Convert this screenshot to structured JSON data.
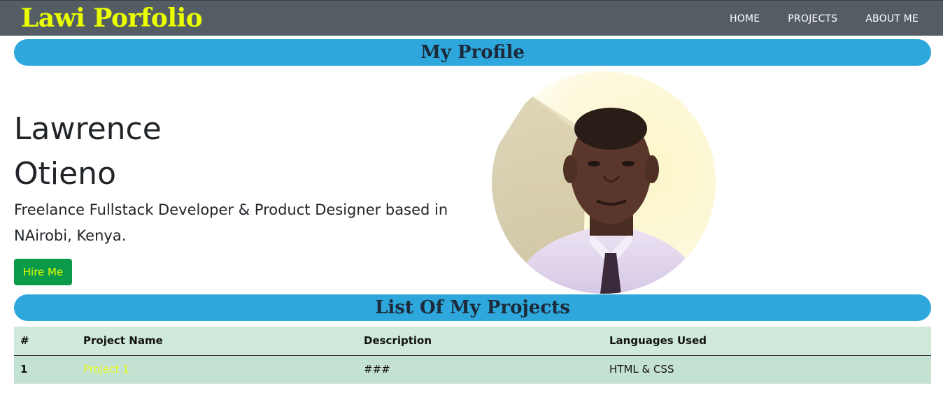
{
  "brand": "Lawi Porfolio",
  "nav": {
    "items": [
      "HOME",
      "PROJECTS",
      "ABOUT ME"
    ]
  },
  "profile_section": {
    "heading": "My Profile",
    "name_first": "Lawrence",
    "name_last": "Otieno",
    "tagline_line1": "Freelance Fullstack Developer & Product Designer based in",
    "tagline_line2": "NAirobi, Kenya.",
    "hire_label": "Hire Me"
  },
  "projects_section": {
    "heading": "List Of My Projects",
    "columns": [
      "#",
      "Project Name",
      "Description",
      "Languages Used"
    ],
    "rows": [
      {
        "num": "1",
        "name": "Project 1",
        "description": "###",
        "languages": "HTML & CSS"
      }
    ]
  },
  "colors": {
    "navbar": "#545d63",
    "brand": "#eaff00",
    "section_bar": "#2ea8dc",
    "hire_button": "#0a9a4a",
    "table_header": "#cfe9db",
    "table_row": "#c4e2d2"
  }
}
